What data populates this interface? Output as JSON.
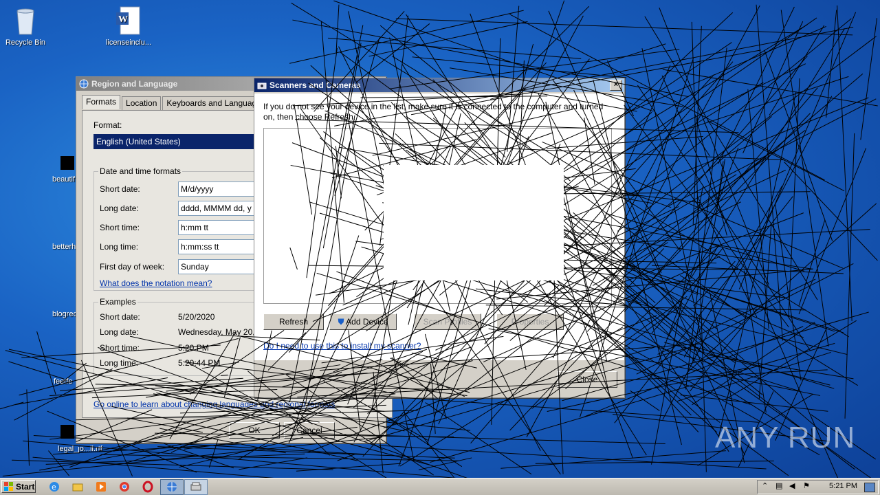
{
  "desktop": {
    "icons": [
      {
        "label": "Recycle Bin",
        "icon": "recycle-bin-icon"
      },
      {
        "label": "licenseinclu...",
        "icon": "word-document-icon"
      }
    ],
    "partial_labels": [
      "beautif",
      "betterh",
      "blogrec",
      "feetfe",
      "legal_jo...ll.rtf"
    ]
  },
  "region_window": {
    "title": "Region and Language",
    "tabs": [
      "Formats",
      "Location",
      "Keyboards and Languages"
    ],
    "format_label": "Format:",
    "format_value": "English (United States)",
    "date_time_group": "Date and time formats",
    "rows": [
      {
        "label": "Short date:",
        "value": "M/d/yyyy"
      },
      {
        "label": "Long date:",
        "value": "dddd, MMMM dd, y"
      },
      {
        "label": "Short time:",
        "value": "h:mm tt"
      },
      {
        "label": "Long time:",
        "value": "h:mm:ss tt"
      },
      {
        "label": "First day of week:",
        "value": "Sunday"
      }
    ],
    "notation_link": "What does the notation mean?",
    "examples_group": "Examples",
    "examples": [
      {
        "label": "Short date:",
        "value": "5/20/2020"
      },
      {
        "label": "Long date:",
        "value": "Wednesday, May 20,"
      },
      {
        "label": "Short time:",
        "value": "5:20 PM"
      },
      {
        "label": "Long time:",
        "value": "5:20:44 PM"
      }
    ],
    "online_link": "Go online to learn about changing languages and regional formats",
    "ok_label": "OK",
    "cancel_label": "Cancel"
  },
  "scanners_window": {
    "title": "Scanners and Cameras",
    "close_glyph": "×",
    "instructions": "If you do not see your device in the list, make sure it is connected to the computer and turned on, then choose Refresh.",
    "refresh_label": "Refresh",
    "add_device_label": "Add Device",
    "scan_profiles_label": "Scan Profiles",
    "properties_label": "Properties",
    "help_link": "Do I need to use this to install my scanner?",
    "close_label": "Close"
  },
  "taskbar": {
    "start_label": "Start",
    "clock": "5:21 PM",
    "pinned": [
      "ie-icon",
      "explorer-icon",
      "media-player-icon",
      "chrome-icon",
      "opera-icon",
      "region-language-icon",
      "scanner-icon"
    ]
  },
  "watermark": "ANY RUN"
}
